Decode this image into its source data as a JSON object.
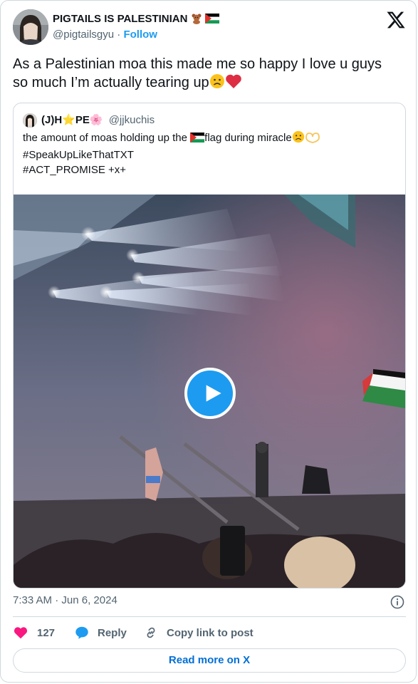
{
  "author": {
    "name": "PIGTAILS IS PALESTINIAN",
    "name_emojis": [
      "teddy-bear-emoji",
      "palestine-flag-emoji"
    ],
    "handle": "@pigtailsgyu",
    "separator": "·",
    "follow_label": "Follow"
  },
  "tweet": {
    "text": "As a Palestinian moa this made me so happy I love u guys so much I’m actually tearing up",
    "trailing_emojis": [
      "frowning-face-emoji",
      "red-heart-emoji"
    ]
  },
  "quote": {
    "name": "(J)H⭐PE🌸",
    "handle": "@jjkuchis",
    "line1_before": "the amount of moas holding up the ",
    "line1_after": "flag during miracle",
    "line2": "#SpeakUpLikeThatTXT",
    "line3": "#ACT_PROMISE +x+"
  },
  "media": {
    "type": "video",
    "play_icon": "play-icon"
  },
  "meta": {
    "time": "7:33 AM",
    "separator": "·",
    "date": "Jun 6, 2024"
  },
  "actions": {
    "like_count": "127",
    "reply_label": "Reply",
    "copy_label": "Copy link to post"
  },
  "read_more_label": "Read more on X",
  "colors": {
    "accent": "#1d9bf0",
    "like": "#f91880",
    "muted": "#536471",
    "border": "#cfd9de",
    "link": "#006fd6"
  }
}
